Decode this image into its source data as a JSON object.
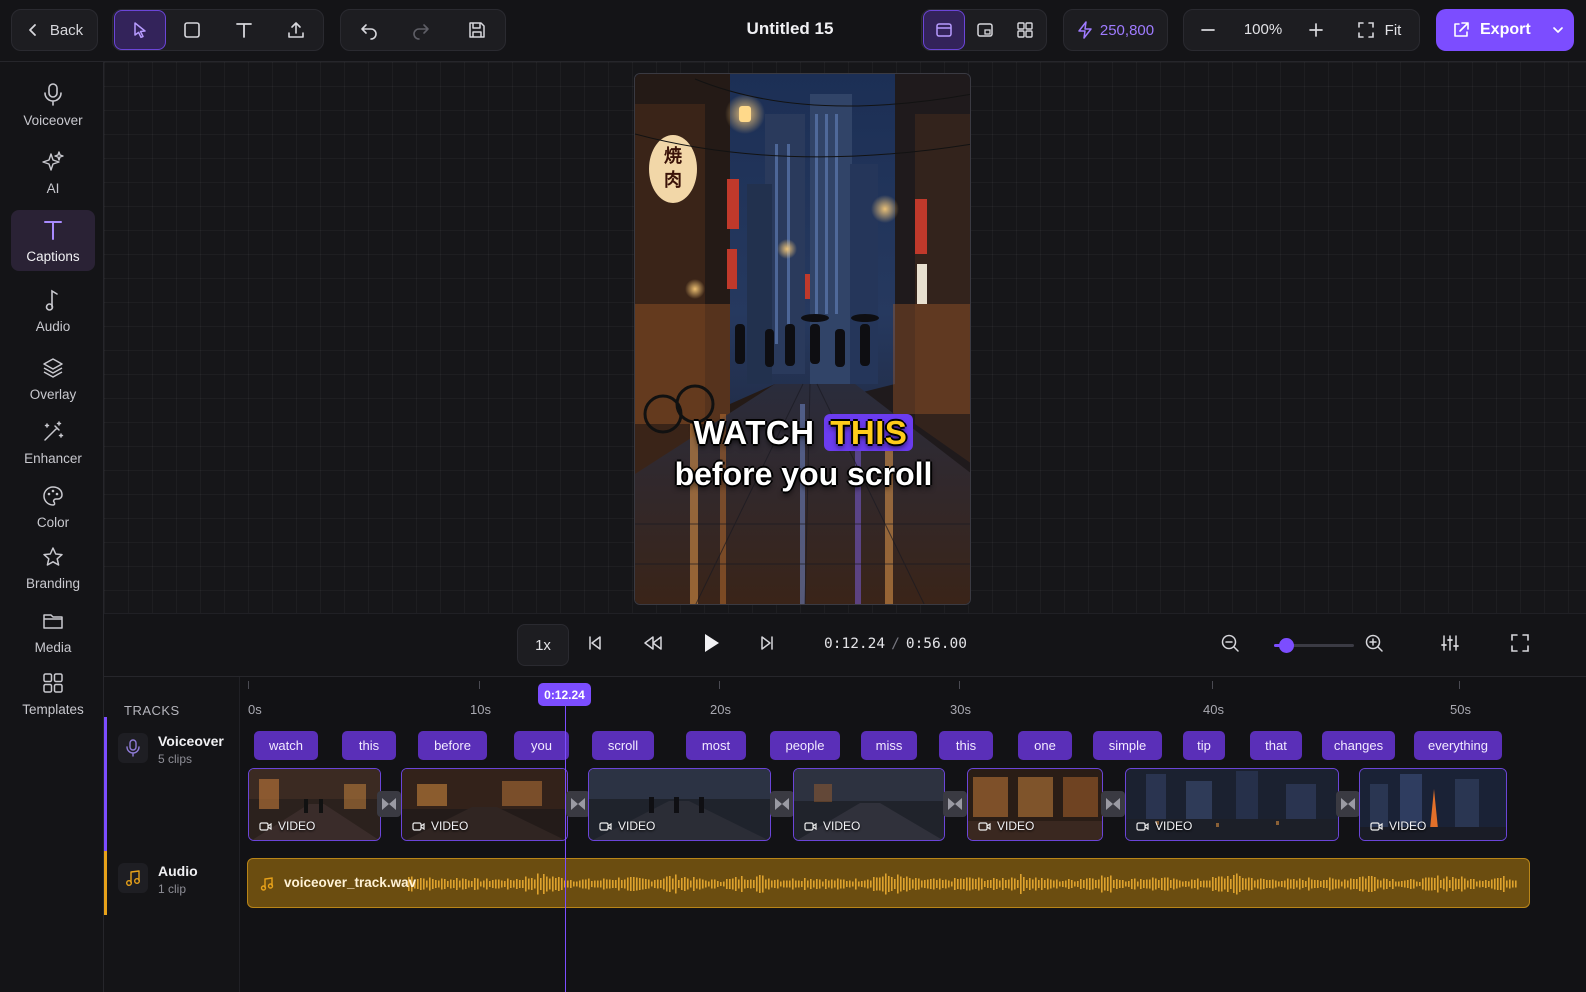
{
  "topbar": {
    "back_label": "Back",
    "title": "Untitled 15",
    "credits": "250,800",
    "zoom": "100%",
    "fit_label": "Fit",
    "export_label": "Export",
    "accent_color": "#7c4dff"
  },
  "sidebar": {
    "items": [
      {
        "label": "Voiceover",
        "icon": "microphone-icon"
      },
      {
        "label": "AI",
        "icon": "sparkles-icon"
      },
      {
        "label": "Captions",
        "icon": "text-icon",
        "active": true
      },
      {
        "label": "Audio",
        "icon": "music-note-icon"
      },
      {
        "label": "Overlay",
        "icon": "layers-icon"
      },
      {
        "label": "Enhancer",
        "icon": "magic-wand-icon"
      },
      {
        "label": "Color",
        "icon": "palette-icon"
      },
      {
        "label": "Branding",
        "icon": "star-icon"
      },
      {
        "label": "Media",
        "icon": "folder-icon"
      },
      {
        "label": "Templates",
        "icon": "grid-icon"
      }
    ]
  },
  "preview": {
    "caption_word1": "WATCH",
    "caption_highlight": "THIS",
    "caption_line2": "before you scroll",
    "sign_text": "焼肉"
  },
  "transport": {
    "speed": "1x",
    "current_time": "0:12.24",
    "separator": "/",
    "total_time": "0:56.00",
    "zoom_level": 0.15
  },
  "timeline": {
    "tracks_label": "TRACKS",
    "playhead": "0:12.24",
    "ruler": [
      "0s",
      "10s",
      "20s",
      "30s",
      "40s",
      "50s"
    ],
    "voiceover_track": {
      "name": "Voiceover",
      "sub": "5 clips"
    },
    "audio_track": {
      "name": "Audio",
      "sub": "1 clip"
    },
    "words": [
      "watch",
      "this",
      "before",
      "you",
      "scroll",
      "most",
      "people",
      "miss",
      "this",
      "one",
      "simple",
      "tip",
      "that",
      "changes",
      "everything"
    ],
    "clip_label": "VIDEO",
    "audio_file": "voiceover_track.wav"
  }
}
